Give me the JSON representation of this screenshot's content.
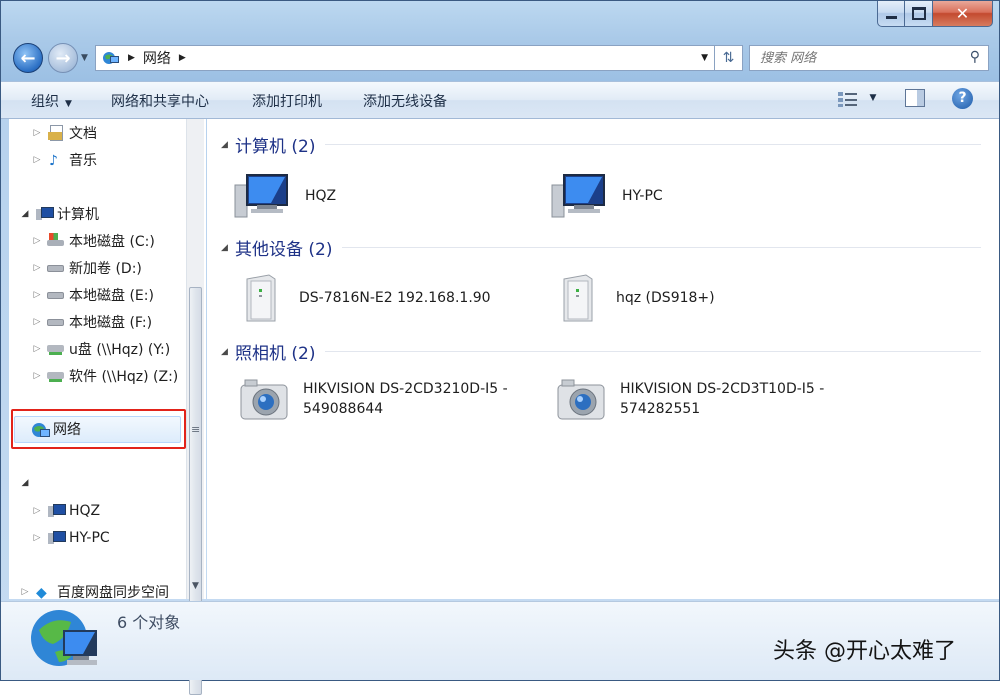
{
  "window": {
    "title": "网络"
  },
  "caption": {
    "minimize_icon": "minimize-icon",
    "maximize_icon": "maximize-icon",
    "close_icon": "close-icon"
  },
  "address": {
    "location": "网络",
    "search_placeholder": "搜索 网络"
  },
  "toolbar": {
    "organize": "组织",
    "network_center": "网络和共享中心",
    "add_printer": "添加打印机",
    "add_wireless": "添加无线设备"
  },
  "sidebar": {
    "items": [
      {
        "label": "文档",
        "icon": "documents-icon"
      },
      {
        "label": "音乐",
        "icon": "music-icon"
      },
      {
        "label": "计算机",
        "icon": "computer-icon"
      },
      {
        "label": "本地磁盘 (C:)",
        "icon": "system-drive-icon"
      },
      {
        "label": "新加卷 (D:)",
        "icon": "drive-icon"
      },
      {
        "label": "本地磁盘 (E:)",
        "icon": "drive-icon"
      },
      {
        "label": "本地磁盘 (F:)",
        "icon": "drive-icon"
      },
      {
        "label": "u盘 (\\\\Hqz) (Y:)",
        "icon": "network-drive-icon"
      },
      {
        "label": "软件 (\\\\Hqz) (Z:)",
        "icon": "network-drive-icon"
      },
      {
        "label": "网络",
        "icon": "network-icon"
      },
      {
        "label": "HQZ",
        "icon": "computer-icon"
      },
      {
        "label": "HY-PC",
        "icon": "computer-icon"
      },
      {
        "label": "百度网盘同步空间",
        "icon": "baidu-sync-icon"
      }
    ]
  },
  "groups": [
    {
      "title": "计算机 (2)",
      "items": [
        {
          "label": "HQZ"
        },
        {
          "label": "HY-PC"
        }
      ]
    },
    {
      "title": "其他设备 (2)",
      "items": [
        {
          "label": "DS-7816N-E2 192.168.1.90"
        },
        {
          "label": "hqz (DS918+)"
        }
      ]
    },
    {
      "title": "照相机 (2)",
      "items": [
        {
          "label": "HIKVISION DS-2CD3210D-I5 -\n549088644"
        },
        {
          "label": "HIKVISION DS-2CD3T10D-I5 -\n574282551"
        }
      ]
    }
  ],
  "status": {
    "count": "6 个对象"
  },
  "watermark": "头条 @开心太难了",
  "colors": {
    "highlight": "#e2231a",
    "group_title": "#1e3287"
  }
}
